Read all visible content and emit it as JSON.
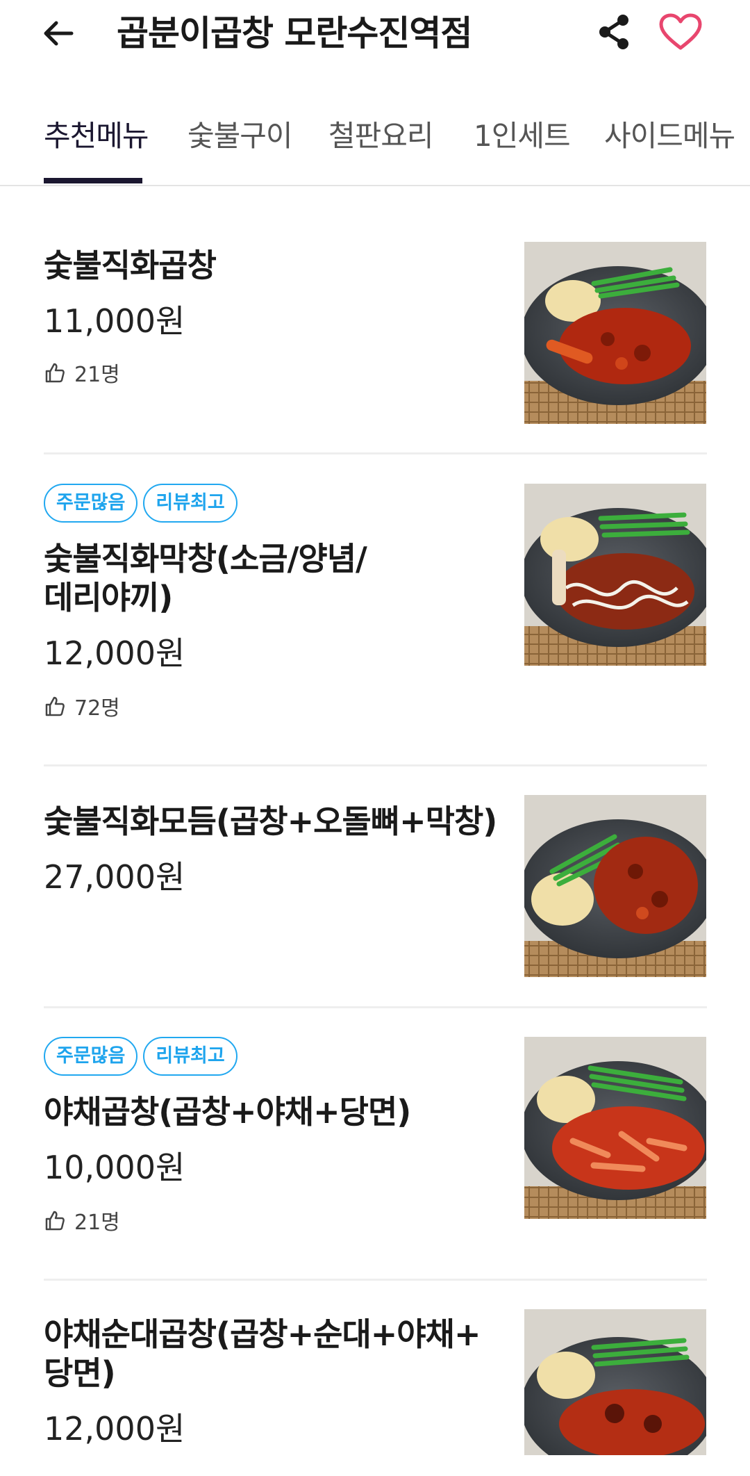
{
  "header": {
    "title": "곱분이곱창 모란수진역점"
  },
  "tabs": [
    "추천메뉴",
    "숯불구이",
    "철판요리",
    "1인세트",
    "사이드메뉴"
  ],
  "colors": {
    "accent": "#1b1730",
    "favorite": "#e8466e",
    "badge": "#1ea4ed"
  },
  "items": [
    {
      "name": "숯불직화곱창",
      "price": "11,000원",
      "likes": "21명",
      "badges": []
    },
    {
      "name": "숯불직화막창(소금/양념/데리야끼)",
      "name_lines": [
        "숯불직화막창(소금/양념/",
        "데리야끼)"
      ],
      "price": "12,000원",
      "likes": "72명",
      "badges": [
        "주문많음",
        "리뷰최고"
      ]
    },
    {
      "name": "숯불직화모듬(곱창+오돌뼈+막창)",
      "price": "27,000원",
      "likes": "",
      "badges": []
    },
    {
      "name": "야채곱창(곱창+야채+당면)",
      "price": "10,000원",
      "likes": "21명",
      "badges": [
        "주문많음",
        "리뷰최고"
      ]
    },
    {
      "name": "야채순대곱창(곱창+순대+야채+당면)",
      "name_lines": [
        "야채순대곱창(곱창+순대+야채+",
        "당면)"
      ],
      "price": "12,000원",
      "likes": "",
      "badges": []
    }
  ]
}
